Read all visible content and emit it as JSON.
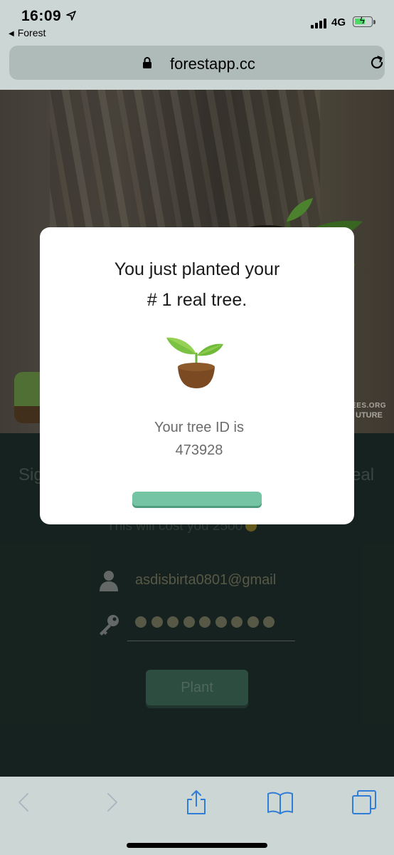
{
  "status_bar": {
    "time": "16:09",
    "back_app_label": "Forest",
    "network": "4G"
  },
  "address_bar": {
    "url": "forestapp.cc"
  },
  "hero": {
    "credit_line1": "EES.ORG",
    "credit_line2": "UTURE"
  },
  "page": {
    "sign_left": "Sig",
    "sign_right": "eal",
    "cost_text": "This will cost you 2500",
    "email_value": "asdisbirta0801@gmail",
    "password_dots": 9,
    "plant_button_label": "Plant"
  },
  "modal": {
    "title_line1": "You just planted your",
    "title_line2": "# 1 real tree.",
    "tree_id_label": "Your tree ID is",
    "tree_id_value": "473928"
  },
  "colors": {
    "accent": "#75c5a5",
    "dark_section": "#1f302b",
    "chrome_bg": "#ccd6d4",
    "link_blue": "#2f7dd6"
  },
  "icons": [
    "location-arrow-icon",
    "signal-icon",
    "battery-icon",
    "lock-icon",
    "reload-icon",
    "user-icon",
    "key-icon",
    "coin-icon",
    "sprout-icon",
    "back-icon",
    "forward-icon",
    "share-icon",
    "bookmarks-icon",
    "tabs-icon"
  ]
}
